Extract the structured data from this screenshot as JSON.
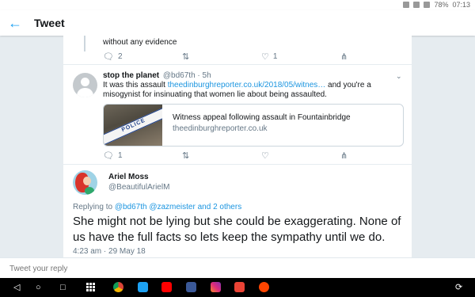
{
  "status_bar": {
    "battery": "78%",
    "time": "07:13"
  },
  "app_bar": {
    "title": "Tweet"
  },
  "prev_tweet": {
    "text": "without any evidence",
    "reply_count": "2",
    "retweet_count": "",
    "like_count": "1"
  },
  "tweet2": {
    "name": "stop the planet",
    "handle": "@bd67th · 5h",
    "text_before": "It was this assault ",
    "link": "theedinburghreporter.co.uk/2018/05/witnes…",
    "text_after": " and you're a misogynist for insinuating that women lie about being assaulted.",
    "card": {
      "title": "Witness appeal following assault in Fountainbridge",
      "domain": "theedinburghreporter.co.uk",
      "image_text": "POLICE"
    },
    "reply_count": "1",
    "retweet_count": "",
    "like_count": ""
  },
  "tweet3": {
    "name": "Ariel Moss",
    "handle": "@BeautifulArielM",
    "replying_prefix": "Replying to ",
    "replying_to": "@bd67th @zazmeister and 2 others",
    "text": "She might not be lying but she could be exaggerating. None of us have the full facts so lets keep the sympathy until we do.",
    "timestamp": "4:23 am · 29 May 18"
  },
  "reply_input": {
    "placeholder": "Tweet your reply"
  },
  "colors": {
    "accent": "#1da1f2",
    "link": "#1b95e0",
    "background": "#e6ecf0"
  }
}
